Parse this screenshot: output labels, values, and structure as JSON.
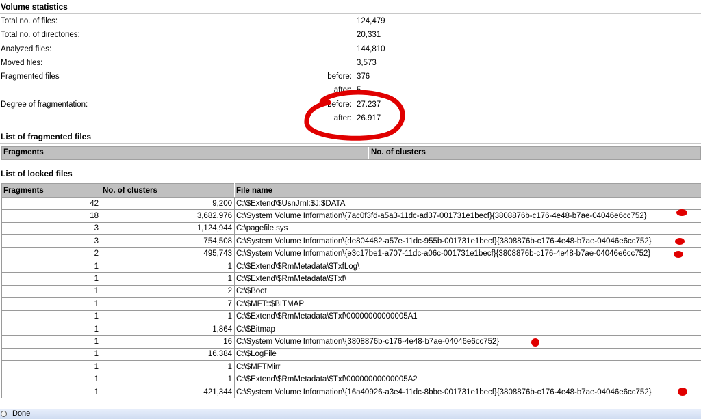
{
  "volume_statistics": {
    "title": "Volume statistics",
    "total_files_label": "Total no. of files:",
    "total_files_value": "124,479",
    "total_dirs_label": "Total no. of directories:",
    "total_dirs_value": "20,331",
    "analyzed_label": "Analyzed files:",
    "analyzed_value": "144,810",
    "moved_label": "Moved files:",
    "moved_value": "3,573",
    "fragmented_label": "Fragmented files",
    "fragmented_before_label": "before:",
    "fragmented_before_value": "376",
    "fragmented_after_label": "after:",
    "fragmented_after_value": "5",
    "degree_label": "Degree of fragmentation:",
    "degree_before_label": "before:",
    "degree_before_value": "27.237",
    "degree_after_label": "after:",
    "degree_after_value": "26.917"
  },
  "fragmented_files": {
    "title": "List of fragmented files",
    "col_fragments": "Fragments",
    "col_clusters": "No. of clusters"
  },
  "locked_files": {
    "title": "List of locked files",
    "col_fragments": "Fragments",
    "col_clusters": "No. of clusters",
    "col_filename": "File name",
    "rows": [
      {
        "fragments": "42",
        "clusters": "9,200",
        "filename": "C:\\$Extend\\$UsnJrnl:$J:$DATA"
      },
      {
        "fragments": "18",
        "clusters": "3,682,976",
        "filename": "C:\\System Volume Information\\{7ac0f3fd-a5a3-11dc-ad37-001731e1becf}{3808876b-c176-4e48-b7ae-04046e6cc752}"
      },
      {
        "fragments": "3",
        "clusters": "1,124,944",
        "filename": "C:\\pagefile.sys"
      },
      {
        "fragments": "3",
        "clusters": "754,508",
        "filename": "C:\\System Volume Information\\{de804482-a57e-11dc-955b-001731e1becf}{3808876b-c176-4e48-b7ae-04046e6cc752}"
      },
      {
        "fragments": "2",
        "clusters": "495,743",
        "filename": "C:\\System Volume Information\\{e3c17be1-a707-11dc-a06c-001731e1becf}{3808876b-c176-4e48-b7ae-04046e6cc752}"
      },
      {
        "fragments": "1",
        "clusters": "1",
        "filename": "C:\\$Extend\\$RmMetadata\\$TxfLog\\"
      },
      {
        "fragments": "1",
        "clusters": "1",
        "filename": "C:\\$Extend\\$RmMetadata\\$Txf\\"
      },
      {
        "fragments": "1",
        "clusters": "2",
        "filename": "C:\\$Boot"
      },
      {
        "fragments": "1",
        "clusters": "7",
        "filename": "C:\\$MFT::$BITMAP"
      },
      {
        "fragments": "1",
        "clusters": "1",
        "filename": "C:\\$Extend\\$RmMetadata\\$Txf\\00000000000005A1"
      },
      {
        "fragments": "1",
        "clusters": "1,864",
        "filename": "C:\\$Bitmap"
      },
      {
        "fragments": "1",
        "clusters": "16",
        "filename": "C:\\System Volume Information\\{3808876b-c176-4e48-b7ae-04046e6cc752}"
      },
      {
        "fragments": "1",
        "clusters": "16,384",
        "filename": "C:\\$LogFile"
      },
      {
        "fragments": "1",
        "clusters": "1",
        "filename": "C:\\$MFTMirr"
      },
      {
        "fragments": "1",
        "clusters": "1",
        "filename": "C:\\$Extend\\$RmMetadata\\$Txf\\00000000000005A2"
      },
      {
        "fragments": "1",
        "clusters": "421,344",
        "filename": "C:\\System Volume Information\\{16a40926-a3e4-11dc-8bbe-001731e1becf}{3808876b-c176-4e48-b7ae-04046e6cc752}"
      }
    ]
  },
  "status_bar": {
    "text": "Done"
  },
  "annotation_color": "#e00000"
}
